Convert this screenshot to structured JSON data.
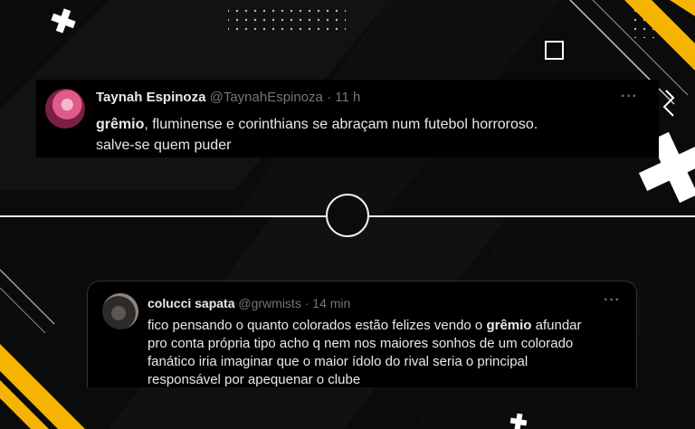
{
  "colors": {
    "accent": "#f5b400",
    "background": "#0b0b0b",
    "card": "#000000",
    "text": "#e7e9ea",
    "muted": "#71767b"
  },
  "tweets": [
    {
      "name": "Taynah Espinoza",
      "handle": "@TaynahEspinoza",
      "separator": "·",
      "time": "11 h",
      "more": "···",
      "highlight": "grêmio",
      "text_after": ", fluminense e corinthians se abraçam num futebol horroroso.",
      "line2": "salve-se quem puder"
    },
    {
      "name": "colucci sapata",
      "handle": "@grwmists",
      "separator": "·",
      "time": "14 min",
      "more": "···",
      "line1_before": "fico pensando o quanto colorados estão felizes vendo o ",
      "highlight": "grêmio",
      "line1_after": " afundar",
      "line2": "pro conta própria tipo acho q nem nos maiores sonhos de um colorado",
      "line3": "fanático iria imaginar que o maior ídolo do rival seria o principal",
      "line4": "responsável por apequenar o clube"
    }
  ]
}
